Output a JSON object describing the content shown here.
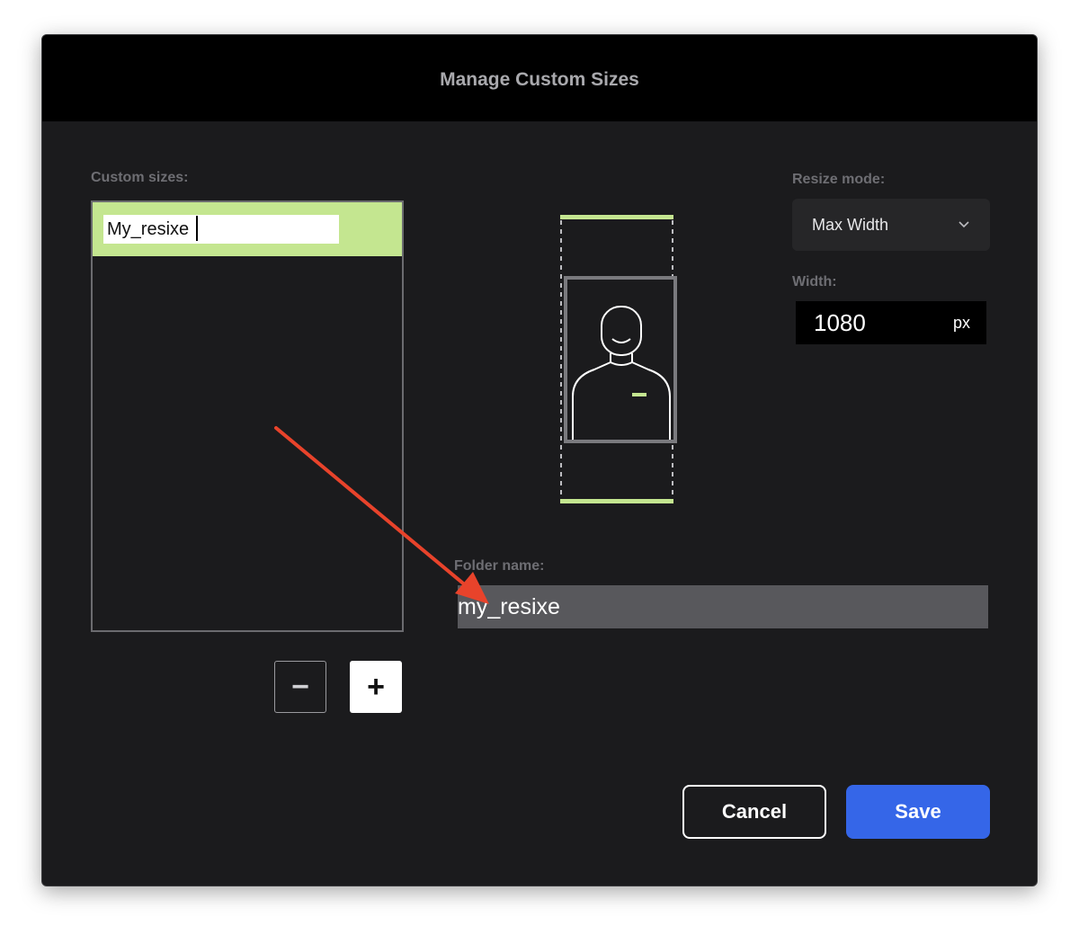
{
  "dialog": {
    "title": "Manage Custom Sizes"
  },
  "custom_sizes": {
    "label": "Custom sizes:",
    "items": [
      {
        "name": "My_resixe",
        "selected": true
      }
    ],
    "remove_label": "−",
    "add_label": "+"
  },
  "resize_mode": {
    "label": "Resize mode:",
    "value": "Max Width"
  },
  "width": {
    "label": "Width:",
    "value": "1080",
    "unit": "px"
  },
  "folder": {
    "label": "Folder name:",
    "value": "my_resixe"
  },
  "actions": {
    "cancel_label": "Cancel",
    "save_label": "Save"
  },
  "colors": {
    "accent_green": "#c4e690",
    "save_blue": "#3566e8",
    "annotation_red": "#e8432b"
  }
}
